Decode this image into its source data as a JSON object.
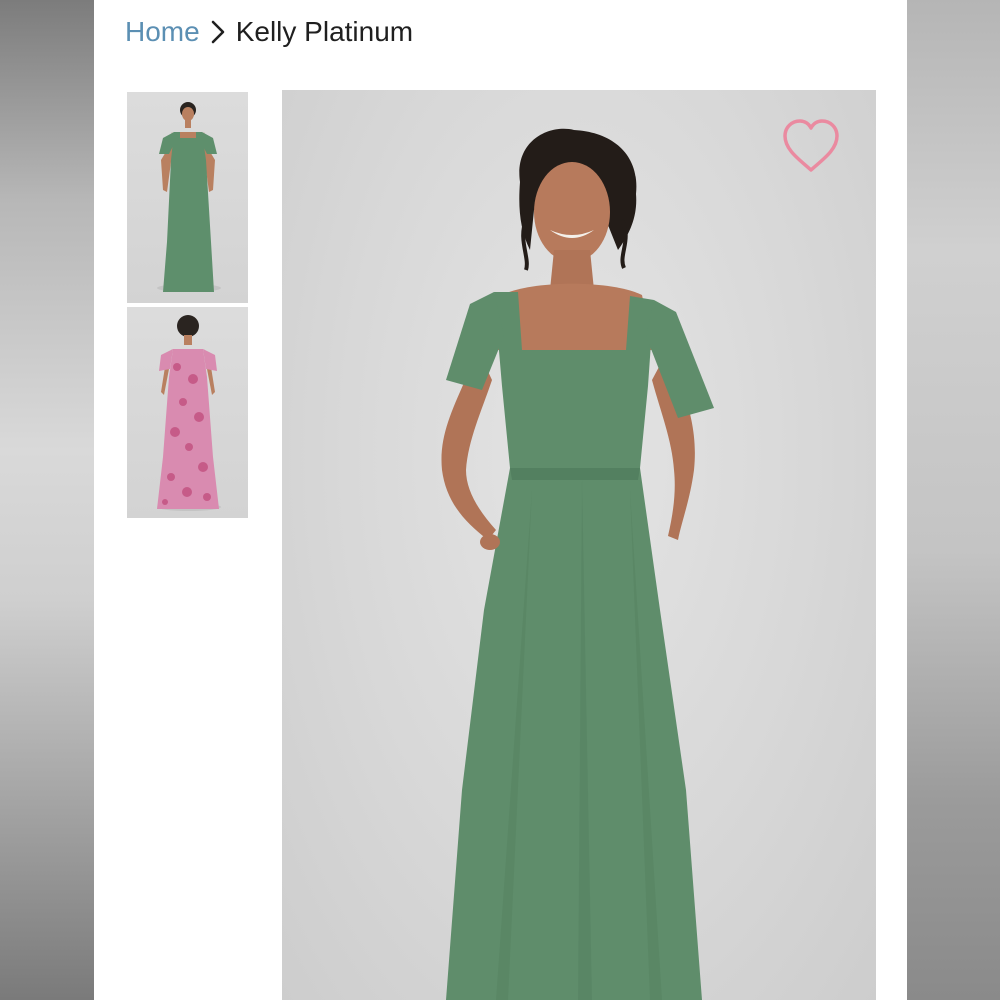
{
  "breadcrumb": {
    "home_label": "Home",
    "separator_icon": "chevron-right-icon",
    "current_label": "Kelly Platinum"
  },
  "gallery": {
    "thumbnails": [
      {
        "name": "front-view",
        "dress_color": "#5e8f6c"
      },
      {
        "name": "back-view",
        "dress_color": "#d98bb0"
      }
    ]
  },
  "hero": {
    "dress_color": "#5f8d6b",
    "favorite_icon": "heart-icon",
    "favorite_color": "#ea8aa0"
  }
}
